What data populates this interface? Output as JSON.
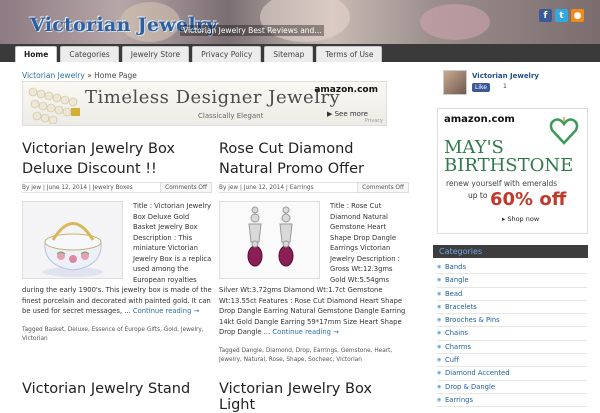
{
  "header": {
    "logo": "Victorian Jewelry",
    "tagline": "Victorian Jewelry Best Reviews and...",
    "social": {
      "fb": "f",
      "tw": "t",
      "rss": "●"
    }
  },
  "nav": {
    "items": [
      "Home",
      "Categories",
      "Jewelry Store",
      "Privacy Policy",
      "Sitemap",
      "Terms of Use"
    ]
  },
  "breadcrumb": {
    "link": "Victorian Jewelry",
    "sep": "»",
    "current": "Home Page"
  },
  "banner": {
    "title": "Timeless Designer Jewelry",
    "subtitle": "Classically Elegant",
    "brand": "amazon.com",
    "cta": "▶ See more",
    "privacy": "Privacy"
  },
  "posts": [
    {
      "title": "Victorian Jewelry Box Deluxe Discount !!",
      "meta": "By jew | June 12, 2014 | Jewelry Boxes",
      "comments": "Comments Off",
      "text": "Title : Victorian Jewelry Box Deluxe Gold Basket Jewelry Box Description : This miniature Victorian Jewelry Box is a replica used among the European royalties during the early 1900's. This jewelry box is made of the finest porcelain and decorated with painted gold. It can be used for secret messages, ...",
      "more": "Continue reading →",
      "tags": "Tagged Basket, Deluxe, Essence of Europe Gifts, Gold, Jewelry, Victorian"
    },
    {
      "title": "Rose Cut Diamond Natural Promo Offer",
      "meta": "By jew | June 12, 2014 | Earrings",
      "comments": "Comments Off",
      "text": "Title : Rose Cut Diamond Natural Gemstone Heart Shape Drop Dangle Earrings Victorian Jewelry Description : Gross Wt:12.3gms Gold Wt:5.54gms Silver Wt:3.72gms Diamond Wt:1.7ct Gemstone Wt:13.55ct Features : Rose Cut Diamond Heart Shape Drop Dangle Earring Natural Gemstone Dangle Earring 14kt Gold Dangle Earring 59*17mm Size Heart Shape Drop Dangle ...",
      "more": "Continue reading →",
      "tags": "Tagged Dangle, Diamond, Drop, Earrings, Gemstone, Heart, Jewelry, Natural, Rose, Shape, Socheec, Victorian"
    }
  ],
  "next_posts": [
    "Victorian Jewelry Stand",
    "Victorian Jewelry Box Light"
  ],
  "sidebar": {
    "profile_name": "Victorian Jewelry",
    "like": "Like",
    "like_count": "1",
    "ad": {
      "brand": "amazon.com",
      "headline1": "MAY'S",
      "headline2": "BIRTHSTONE",
      "sub": "renew yourself with emeralds",
      "upto": "up to",
      "off": "60% off",
      "shop": "▸ Shop now"
    },
    "categories_title": "Categories",
    "categories": [
      "Bands",
      "Bangle",
      "Bead",
      "Bracelets",
      "Brooches & Pins",
      "Chains",
      "Charms",
      "Cuff",
      "Diamond Accented",
      "Drop & Dangle",
      "Earrings"
    ]
  }
}
